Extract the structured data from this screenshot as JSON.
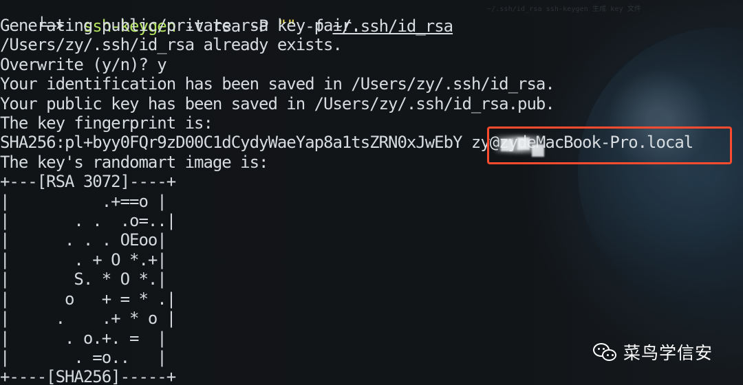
{
  "terminal": {
    "faint_path_text": "~/.ssh/id_rsa  ssh-keygen  生成 key 文件",
    "prompt": {
      "arrow": "└─➤",
      "command": "ssh-keygen",
      "args_before_quote": " -t rsa -P ",
      "quote": "\"\"",
      "args_after_quote": " -f ",
      "path": "~/.ssh/id_rsa"
    },
    "output_lines": [
      "Generating public/private rsa key pair.",
      "/Users/zy/.ssh/id_rsa already exists.",
      "Overwrite (y/n)? y",
      "Your identification has been saved in /Users/zy/.ssh/id_rsa.",
      "Your public key has been saved in /Users/zy/.ssh/id_rsa.pub.",
      "The key fingerprint is:",
      "SHA256:pl+byy0FQr9zD00C1dCydyWaeYap8a1tsZRN0xJwEbY zy@zydeMacBook-Pro.local",
      "The key's randomart image is:"
    ],
    "randomart": [
      "+---[RSA 3072]----+",
      "|          .+==o |",
      "|       . .  .o=..|",
      "|      . . . OEoo|",
      "|       . + O *.+|",
      "|       S. * O *.|",
      "|      o   + = * .|",
      "|     .    .+ * o |",
      "|      . o.+. =  |",
      "|       . =o..   |",
      "+----[SHA256]-----+"
    ]
  },
  "watermark": {
    "icon": "wechat-icon",
    "text": "菜鸟学信安"
  },
  "colors": {
    "background": "#111417",
    "terminal_text": "#d7dce0",
    "command": "#b3e35f",
    "quote": "#e0d84d",
    "highlight": "#ff4b2e",
    "watermark": "#ffffff"
  }
}
